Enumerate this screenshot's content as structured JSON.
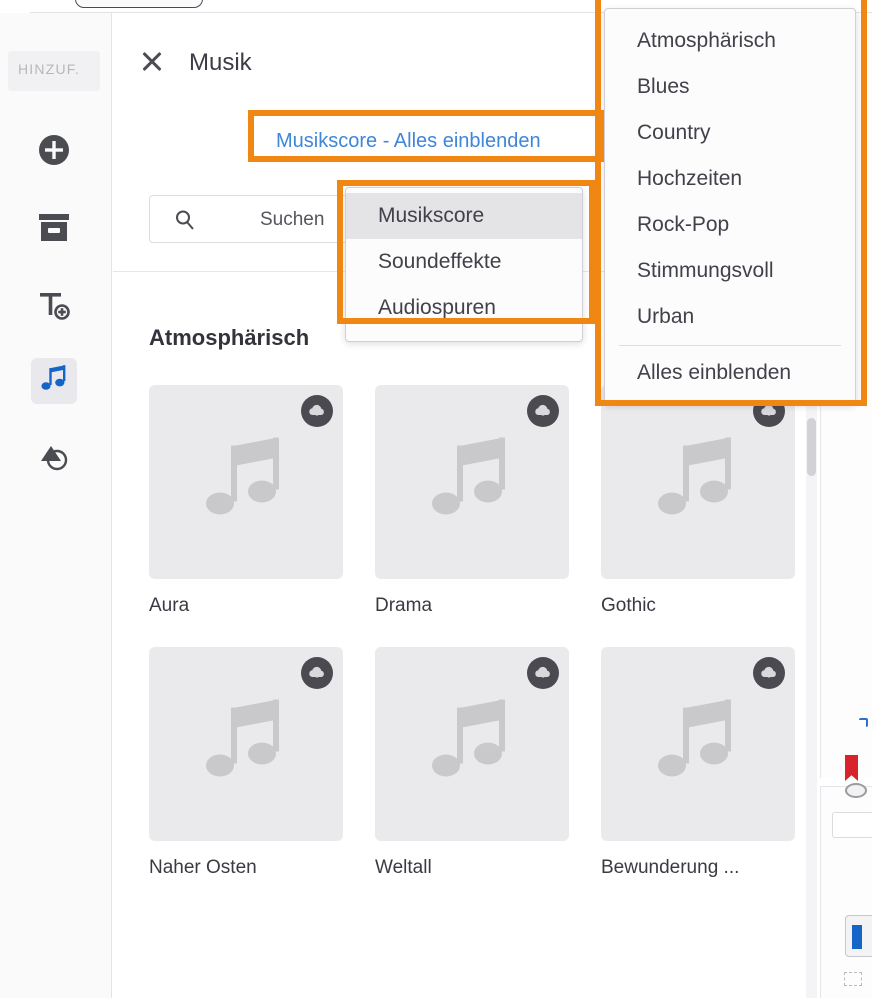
{
  "sidebar": {
    "add_label": "HINZUF.",
    "items": [
      {
        "name": "plus-circle-icon",
        "label": "Hinzufügen",
        "selected": false
      },
      {
        "name": "archive-box-icon",
        "label": "Medien",
        "selected": false
      },
      {
        "name": "text-add-icon",
        "label": "Text",
        "selected": false
      },
      {
        "name": "music-note-icon",
        "label": "Musik",
        "selected": true
      },
      {
        "name": "transition-icon",
        "label": "Übergänge",
        "selected": false
      }
    ]
  },
  "panel": {
    "title": "Musik",
    "close_icon": "close-icon",
    "breadcrumb": "Musikscore - Alles einblenden",
    "search": {
      "icon": "search-icon",
      "placeholder": "Suchen",
      "value": ""
    },
    "section_title": "Atmosphärisch"
  },
  "tiles": {
    "rows": [
      [
        {
          "label": "Aura",
          "icon": "music-note-icon",
          "badge": "cloud-download-icon"
        },
        {
          "label": "Drama",
          "icon": "music-note-icon",
          "badge": "cloud-download-icon"
        },
        {
          "label": "Gothic",
          "icon": "music-note-icon",
          "badge": "cloud-download-icon"
        }
      ],
      [
        {
          "label": "Naher Osten",
          "icon": "music-note-icon",
          "badge": "cloud-download-icon"
        },
        {
          "label": "Weltall",
          "icon": "music-note-icon",
          "badge": "cloud-download-icon"
        },
        {
          "label": "Bewunderung ...",
          "icon": "music-note-icon",
          "badge": "cloud-download-icon"
        }
      ]
    ]
  },
  "menu_type": {
    "items": [
      {
        "label": "Musikscore",
        "highlighted": true
      },
      {
        "label": "Soundeffekte",
        "highlighted": false
      },
      {
        "label": "Audiospuren",
        "highlighted": false
      }
    ]
  },
  "menu_category": {
    "items": [
      {
        "label": "Atmosphärisch"
      },
      {
        "label": "Blues"
      },
      {
        "label": "Country"
      },
      {
        "label": "Hochzeiten"
      },
      {
        "label": "Rock-Pop"
      },
      {
        "label": "Stimmungsvoll"
      },
      {
        "label": "Urban"
      }
    ],
    "footer": "Alles einblenden"
  },
  "colors": {
    "accent_blue": "#3f86d8",
    "selected_icon_blue": "#1565c8",
    "annotation_orange": "#f08712",
    "tile_bg": "#eaeaec",
    "badge_dark": "#4a4a50"
  }
}
